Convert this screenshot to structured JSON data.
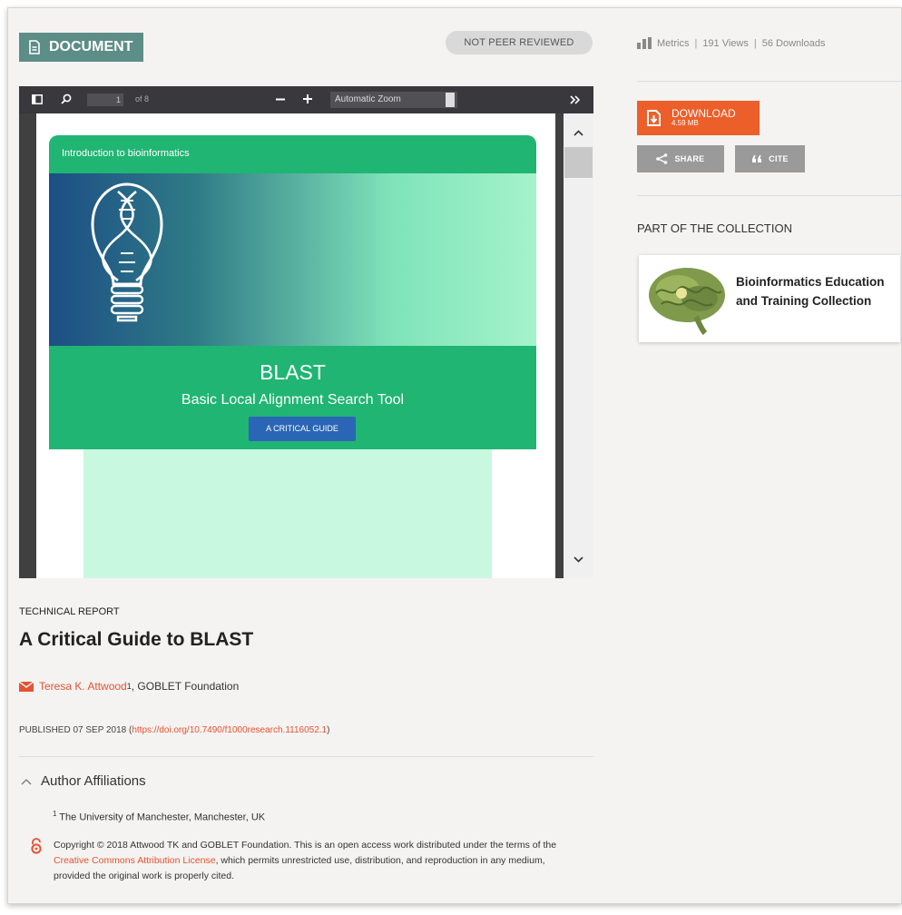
{
  "badges": {
    "document_label": "DOCUMENT",
    "peer_review_status": "NOT PEER REVIEWED"
  },
  "pdf_viewer": {
    "current_page": "1",
    "page_count_text": "of 8",
    "zoom_value": "Automatic Zoom",
    "icons": [
      "sidebar-toggle-icon",
      "search-icon",
      "zoom-out-icon",
      "zoom-in-icon",
      "more-tools-icon",
      "scroll-up-icon",
      "scroll-down-icon"
    ]
  },
  "pdf_cover": {
    "header_text": "Introduction to bioinformatics",
    "title": "BLAST",
    "subtitle": "Basic Local Alignment Search Tool",
    "button_label": "A CRITICAL GUIDE"
  },
  "article": {
    "type": "TECHNICAL REPORT",
    "title": "A Critical Guide to BLAST",
    "author_name": "Teresa K. Attwood",
    "author_sup": "1",
    "author_org": " , GOBLET Foundation",
    "published_prefix": "PUBLISHED 07 SEP 2018 (",
    "doi_link": "https://doi.org/10.7490/f1000research.1116052.1",
    "published_suffix": ")"
  },
  "affiliations": {
    "heading": "Author Affiliations",
    "items": [
      {
        "sup": "1",
        "text": " The University of Manchester, Manchester, UK"
      }
    ]
  },
  "copyright": {
    "text_before": "Copyright © 2018 Attwood TK and GOBLET Foundation. This is an open access work distributed under the terms of the ",
    "license_link": "Creative Commons Attribution License",
    "text_after": ", which permits unrestricted use, distribution, and reproduction in any medium, provided the original work is properly cited."
  },
  "metrics": {
    "label": "Metrics",
    "views": "191 Views",
    "downloads": "56 Downloads"
  },
  "actions": {
    "download_label": "DOWNLOAD",
    "download_size": "4.59 MB",
    "share_label": "SHARE",
    "cite_label": "CITE"
  },
  "collection": {
    "heading": "PART OF THE COLLECTION",
    "title": "Bioinformatics Education and Training Collection"
  },
  "colors": {
    "accent_orange": "#ec5f2a",
    "badge_teal": "#5c8d87",
    "cover_green": "#20b573",
    "link_red": "#e55332"
  }
}
